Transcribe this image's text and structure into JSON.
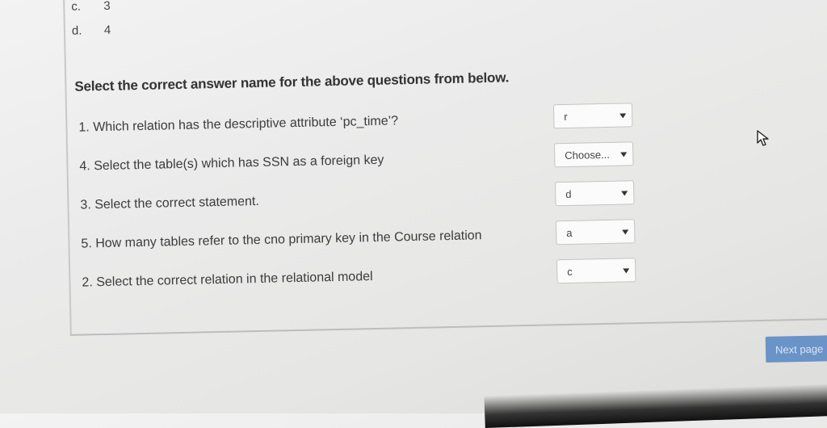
{
  "options": [
    {
      "letter": "c.",
      "value": "3"
    },
    {
      "letter": "d.",
      "value": "4"
    }
  ],
  "instruction": "Select the correct answer name for the above questions from below.",
  "questions": [
    {
      "text": "1. Which relation has the descriptive attribute ‘pc_time’?",
      "selected": "r"
    },
    {
      "text": "4. Select the table(s) which has SSN as a foreign key",
      "selected": "Choose..."
    },
    {
      "text": "3. Select the correct statement.",
      "selected": "d"
    },
    {
      "text": "5. How many tables refer to the cno primary key in the Course relation",
      "selected": "a"
    },
    {
      "text": "2. Select the correct relation in the relational model",
      "selected": "c"
    }
  ],
  "next_button_label": "Next page",
  "icons": {
    "dropdown": "chevron-down-icon",
    "cursor": "mouse-pointer-icon"
  },
  "colors": {
    "next_button": "#6a93c7",
    "panel_border": "#c8c8c8"
  }
}
